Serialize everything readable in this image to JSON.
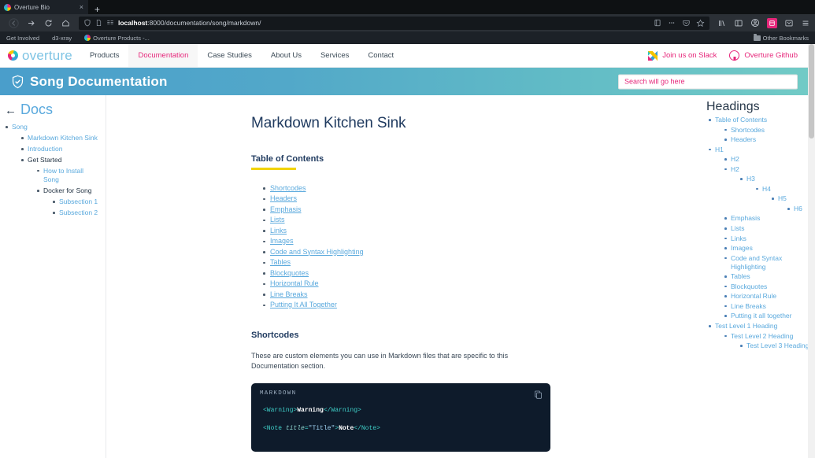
{
  "browser": {
    "tab": {
      "title": "Overture Bio",
      "favicon": "overture-favicon",
      "close_label": "×"
    },
    "new_tab_label": "+",
    "nav": {
      "back": "back-arrow",
      "forward": "forward-arrow",
      "reload": "reload-icon",
      "home": "home-icon"
    },
    "url": {
      "host": "localhost",
      "rest": ":8000/documentation/song/markdown/"
    },
    "url_icons": [
      "shield-icon",
      "page-icon",
      "reader-icon"
    ],
    "url_right_icons": [
      "save-to-pocket-icon",
      "more-icon",
      "pocket-icon",
      "bookmark-star-icon"
    ],
    "toolbar_icons": [
      "library-icon",
      "sidebar-icon",
      "account-icon",
      "extension-pink-icon",
      "extension-icon",
      "app-menu-icon"
    ],
    "bookmarks": [
      {
        "label": "Get Involved",
        "favicon": false
      },
      {
        "label": "d3-xray",
        "favicon": false
      },
      {
        "label": "Overture Products -...",
        "favicon": true
      }
    ],
    "other_bookmarks": "Other Bookmarks"
  },
  "site": {
    "logo_text": "overture",
    "nav": [
      {
        "label": "Products",
        "active": false
      },
      {
        "label": "Documentation",
        "active": true
      },
      {
        "label": "Case Studies",
        "active": false
      },
      {
        "label": "About Us",
        "active": false
      },
      {
        "label": "Services",
        "active": false
      },
      {
        "label": "Contact",
        "active": false
      }
    ],
    "slack_link": "Join us on Slack",
    "github_link": "Overture Github"
  },
  "banner": {
    "title": "Song Documentation",
    "icon": "shield-check-icon",
    "gradient_start": "#4a9ecb",
    "gradient_end": "#72cbc6"
  },
  "search": {
    "placeholder": "Search will go here",
    "value": "",
    "color": "#e6267a"
  },
  "sidebar_left": {
    "back_label": "Docs",
    "back_arrow": "←",
    "items": [
      {
        "label": "Song",
        "link": true,
        "children": [
          {
            "label": "Markdown Kitchen Sink",
            "link": true,
            "children": []
          },
          {
            "label": "Introduction",
            "link": true,
            "children": []
          },
          {
            "label": "Get Started",
            "link": false,
            "children": [
              {
                "label": "How to Install Song",
                "link": true,
                "children": []
              },
              {
                "label": "Docker for Song",
                "link": false,
                "children": [
                  {
                    "label": "Subsection 1",
                    "link": true,
                    "children": []
                  },
                  {
                    "label": "Subsection 2",
                    "link": true,
                    "children": []
                  }
                ]
              }
            ]
          }
        ]
      }
    ]
  },
  "article": {
    "title": "Markdown Kitchen Sink",
    "toc_heading": "Table of Contents",
    "toc": [
      "Shortcodes",
      "Headers",
      "Emphasis",
      "Lists",
      "Links",
      "Images",
      "Code and Syntax Highlighting",
      "Tables",
      "Blockquotes",
      "Horizontal Rule",
      "Line Breaks",
      "Putting It All Together"
    ],
    "shortcodes_heading": "Shortcodes",
    "shortcodes_para": "These are custom elements you can use in Markdown files that are specific to this Documentation section.",
    "code": {
      "language": "MARKDOWN",
      "copy_icon": "copy-icon",
      "lines": [
        [
          {
            "t": "<Warning>",
            "c": "ctag"
          },
          {
            "t": "Warning",
            "c": "ctxt"
          },
          {
            "t": "</Warning>",
            "c": "ctag"
          }
        ],
        [
          {
            "t": "<Note ",
            "c": "ctag"
          },
          {
            "t": "title",
            "c": "cattr"
          },
          {
            "t": "=",
            "c": "ctag"
          },
          {
            "t": "\"Title\"",
            "c": "cval"
          },
          {
            "t": ">",
            "c": "ctag"
          },
          {
            "t": "Note",
            "c": "ctxt"
          },
          {
            "t": "</Note>",
            "c": "ctag"
          }
        ]
      ]
    }
  },
  "sidebar_right": {
    "heading": "Headings",
    "items": [
      {
        "label": "Table of Contents",
        "children": [
          {
            "label": "Shortcodes",
            "children": []
          },
          {
            "label": "Headers",
            "children": []
          }
        ]
      },
      {
        "label": "H1",
        "children": [
          {
            "label": "H2",
            "children": []
          },
          {
            "label": "H2",
            "children": [
              {
                "label": "H3",
                "children": [
                  {
                    "label": "H4",
                    "children": [
                      {
                        "label": "H5",
                        "children": [
                          {
                            "label": "H6",
                            "children": []
                          }
                        ]
                      }
                    ]
                  }
                ]
              }
            ]
          },
          {
            "label": "Emphasis",
            "children": []
          },
          {
            "label": "Lists",
            "children": []
          },
          {
            "label": "Links",
            "children": []
          },
          {
            "label": "Images",
            "children": []
          },
          {
            "label": "Code and Syntax Highlighting",
            "children": []
          },
          {
            "label": "Tables",
            "children": []
          },
          {
            "label": "Blockquotes",
            "children": []
          },
          {
            "label": "Horizontal Rule",
            "children": []
          },
          {
            "label": "Line Breaks",
            "children": []
          },
          {
            "label": "Putting it all together",
            "children": []
          }
        ]
      },
      {
        "label": "Test Level 1 Heading",
        "children": [
          {
            "label": "Test Level 2 Heading",
            "children": [
              {
                "label": "Test Level 3 Heading",
                "children": []
              }
            ]
          }
        ]
      }
    ]
  }
}
